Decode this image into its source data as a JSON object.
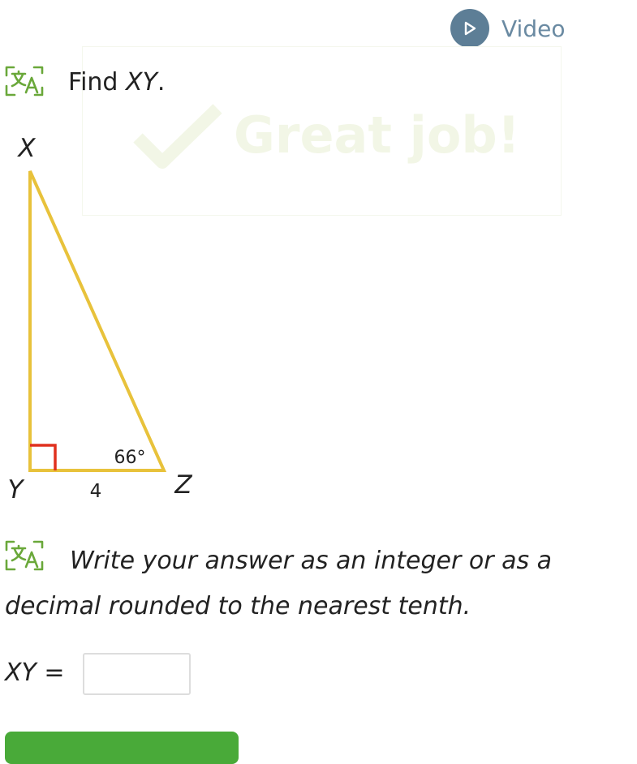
{
  "header": {
    "video_label": "Video",
    "video_icon": "play-icon",
    "accent_color": "#5d7e96"
  },
  "feedback": {
    "text": "Great job!",
    "icon": "checkmark-icon",
    "color": "#f2f6e6"
  },
  "question": {
    "prompt_prefix": "Find ",
    "prompt_var": "XY",
    "prompt_suffix": ".",
    "translate_icon": "translate-icon"
  },
  "diagram": {
    "vertex_x": "X",
    "vertex_y": "Y",
    "vertex_z": "Z",
    "side_yz": "4",
    "angle_z": "66°",
    "right_angle_at": "Y",
    "triangle_color": "#e8c23b",
    "right_angle_color": "#e0301e"
  },
  "instruction": {
    "text": "Write your answer as an integer or as a decimal rounded to the nearest tenth."
  },
  "answer": {
    "label_var": "XY",
    "label_eq": " =",
    "value": "",
    "placeholder": ""
  },
  "submit": {
    "color": "#49aa39"
  }
}
